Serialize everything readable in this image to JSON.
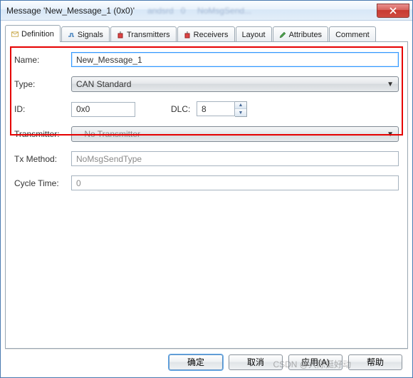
{
  "title": "Message 'New_Message_1 (0x0)'",
  "tabs": {
    "definition": "Definition",
    "signals": "Signals",
    "transmitters": "Transmitters",
    "receivers": "Receivers",
    "layout": "Layout",
    "attributes": "Attributes",
    "comment": "Comment"
  },
  "form": {
    "name_label": "Name:",
    "name_value": "New_Message_1",
    "type_label": "Type:",
    "type_value": "CAN Standard",
    "id_label": "ID:",
    "id_value": "0x0",
    "dlc_label": "DLC:",
    "dlc_value": "8",
    "transmitter_label": "Transmitter:",
    "transmitter_value": "-- No Transmitter --",
    "txmethod_label": "Tx Method:",
    "txmethod_value": "NoMsgSendType",
    "cycle_label": "Cycle Time:",
    "cycle_value": "0"
  },
  "buttons": {
    "ok": "确定",
    "cancel": "取消",
    "apply": "应用(A)",
    "help": "帮助"
  },
  "watermark": "CSDN @大陈挺好动"
}
